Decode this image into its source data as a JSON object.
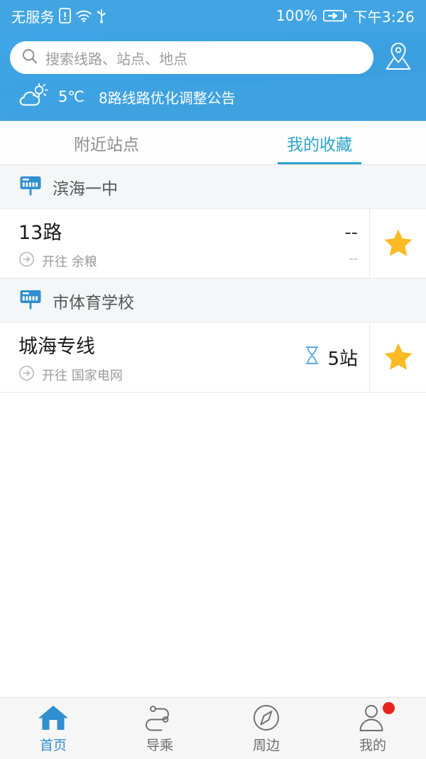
{
  "statusbar": {
    "carrier": "无服务",
    "sim_icon": "sim-card-alert-icon",
    "wifi_icon": "wifi-icon",
    "usb_icon": "usb-icon",
    "battery_percent": "100%",
    "battery_icon": "battery-charging-icon",
    "time": "下午3:26"
  },
  "header": {
    "search": {
      "icon": "search-icon",
      "placeholder": "搜索线路、站点、地点",
      "value": ""
    },
    "map_button_icon": "map-pin-icon",
    "weather": {
      "icon": "sun-cloud-icon",
      "temperature": "5℃",
      "notice": "8路线路优化调整公告"
    }
  },
  "tabs": [
    {
      "label": "附近站点",
      "active": false
    },
    {
      "label": "我的收藏",
      "active": true
    }
  ],
  "groups": [
    {
      "station_icon": "bus-stop-sign-icon",
      "station_name": "滨海一中",
      "routes": [
        {
          "name": "13路",
          "direction_icon": "arrow-right-circle-icon",
          "direction": "开往 余粮",
          "eta_icon": "",
          "eta": "--",
          "eta_sub": "--",
          "star_icon": "star-filled-icon",
          "favorited": true
        }
      ]
    },
    {
      "station_icon": "bus-stop-sign-icon",
      "station_name": "市体育学校",
      "routes": [
        {
          "name": "城海专线",
          "direction_icon": "arrow-right-circle-icon",
          "direction": "开往 国家电网",
          "eta_icon": "hourglass-icon",
          "eta": "5站",
          "eta_sub": "",
          "star_icon": "star-filled-icon",
          "favorited": true
        }
      ]
    }
  ],
  "bottom_nav": [
    {
      "label": "首页",
      "icon": "home-icon",
      "active": true,
      "badge": false
    },
    {
      "label": "导乘",
      "icon": "route-transfer-icon",
      "active": false,
      "badge": false
    },
    {
      "label": "周边",
      "icon": "compass-icon",
      "active": false,
      "badge": false
    },
    {
      "label": "我的",
      "icon": "person-icon",
      "active": false,
      "badge": true
    }
  ],
  "colors": {
    "header_blue": "#3ba0e0",
    "accent_tab": "#2ba4cc",
    "star_gold": "#fbba26",
    "badge_red": "#e8241c",
    "nav_active": "#2f8fcf"
  }
}
